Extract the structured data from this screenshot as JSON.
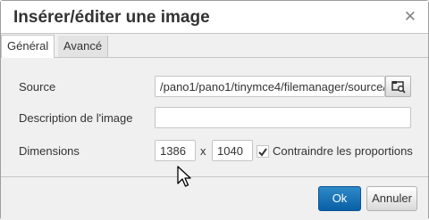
{
  "dialog": {
    "title": "Insérer/éditer une image",
    "close_icon": "close-icon"
  },
  "tabs": [
    {
      "label": "Général",
      "active": true
    },
    {
      "label": "Avancé",
      "active": false
    }
  ],
  "form": {
    "source_label": "Source",
    "source_value": "/pano1/pano1/tinymce4/filemanager/source/",
    "browse_icon": "browse-folder-icon",
    "description_label": "Description de l'image",
    "description_value": "",
    "dimensions_label": "Dimensions",
    "width_value": "1386",
    "separator": "x",
    "height_value": "1040",
    "constrain_label": "Contraindre les proportions",
    "constrain_checked": true
  },
  "footer": {
    "ok_label": "Ok",
    "cancel_label": "Annuler"
  },
  "colors": {
    "primary": "#0a5fa6",
    "border": "#c5c5c5"
  }
}
